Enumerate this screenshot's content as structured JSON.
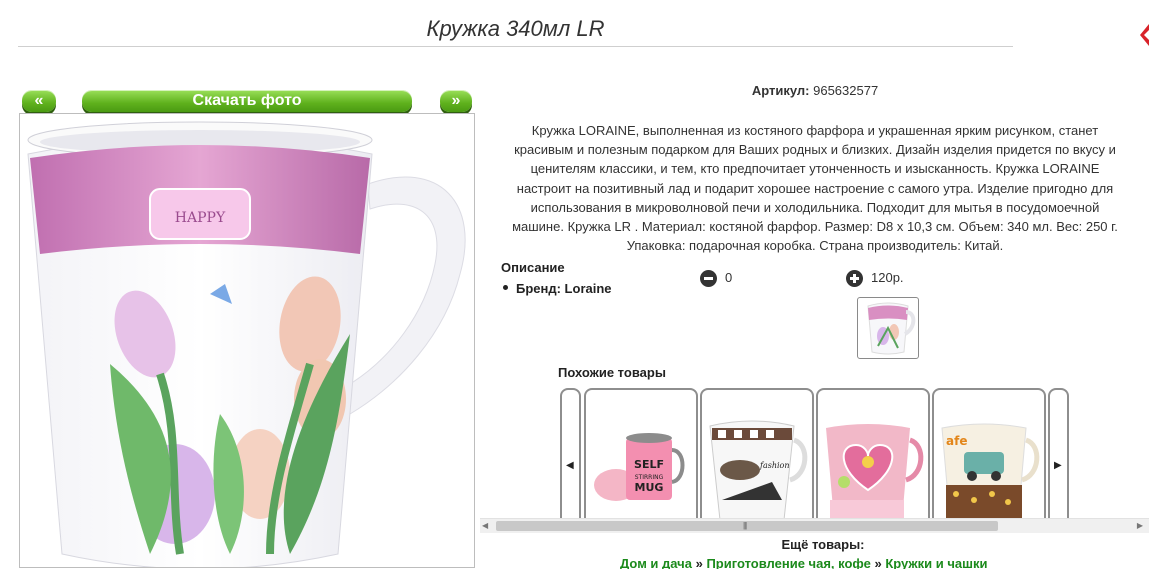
{
  "page": {
    "title": "Кружка 340мл LR"
  },
  "photo_nav": {
    "prev_label": "«",
    "download_label": "Скачать фото",
    "next_label": "»"
  },
  "product": {
    "sku_label": "Артикул:",
    "sku_value": "965632577",
    "description_lines": [
      "Кружка LORAINE, выполненная из костяного фарфора и украшенная ярким рисунком, станет",
      "красивым и полезным подарком для Ваших родных и близких. Дизайн изделия придется по вкусу и",
      "ценителям классики, и тем, кто предпочитает утонченность и изысканность. Кружка LORAINE",
      "настроит на позитивный лад и подарит хорошее настроение с самого утра. Изделие пригодно для",
      "использования в микроволновой печи и холодильника. Подходит для мытья в посудомоечной",
      "машине. Кружка LR . Материал: костяной фарфор. Размер: D8 х 10,3 см. Объем: 340 мл. Вес: 250 г.",
      "Упаковка: подарочная коробка. Страна производитель: Китай."
    ],
    "specs_title": "Описание",
    "brand_item": "Бренд: Loraine",
    "minus_value": "0",
    "plus_value": "120р."
  },
  "similar": {
    "title": "Похожие товары",
    "cards": [
      {
        "name": "self-stirring-mug",
        "text_lines": [
          "SELF",
          "STIRRING",
          "MUG"
        ]
      },
      {
        "name": "fashion-mug",
        "text_lines": [
          "fashion"
        ]
      },
      {
        "name": "heart-mug",
        "text_lines": []
      },
      {
        "name": "cafe-car-mug",
        "text_lines": [
          "afe"
        ]
      }
    ]
  },
  "more": {
    "title": "Ещё товары:",
    "crumbs": [
      "Дом и дача",
      "Приготовление чая, кофе",
      "Кружки и чашки"
    ],
    "separator": "»"
  },
  "colors": {
    "accent_green": "#5fb11d",
    "link_green": "#1b8a1b",
    "mug_pink": "#d98fc2"
  },
  "icons": [
    "minus-circle-icon",
    "plus-circle-icon",
    "chevron-left-icon",
    "chevron-right-icon"
  ]
}
